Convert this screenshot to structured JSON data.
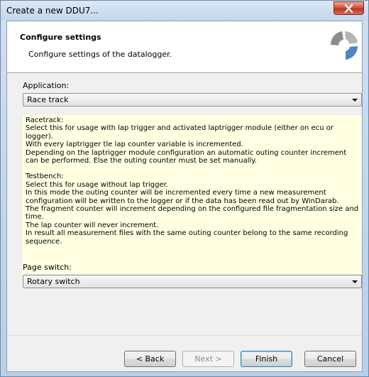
{
  "window": {
    "title": "Create a new DDU7..."
  },
  "header": {
    "title": "Configure settings",
    "subtitle": "Configure settings of the datalogger."
  },
  "application": {
    "label": "Application:",
    "value": "Race track"
  },
  "info": {
    "paragraphs": [
      "Racetrack:",
      "Select this for usage with lap trigger and activated laptrigger module (either on ecu or logger).",
      "With every laptrigger tle lap counter variable is incremented.",
      "Depending on the laptrigger module configuration an automatic outing counter increment can be performed. Else the outing counter must be set manually.",
      "Testbench:",
      "Select this for usage without lap trigger.",
      "In this mode the outing counter will be incremented every time a new measurement configuration will be written to the logger or if the data has been read out by WinDarab.",
      "The fragment counter will increment depending on the configured file fragmentation size and time.",
      "The lap counter will never increment.",
      "In result all measurement files with the same outing counter belong to the same recording sequence."
    ]
  },
  "page_switch": {
    "label": "Page switch:",
    "value": "Rotary switch"
  },
  "buttons": {
    "back": "< Back",
    "next": "Next >",
    "finish": "Finish",
    "cancel": "Cancel"
  },
  "colors": {
    "info_background": "#ffffe1",
    "close_button": "#c0341f"
  }
}
